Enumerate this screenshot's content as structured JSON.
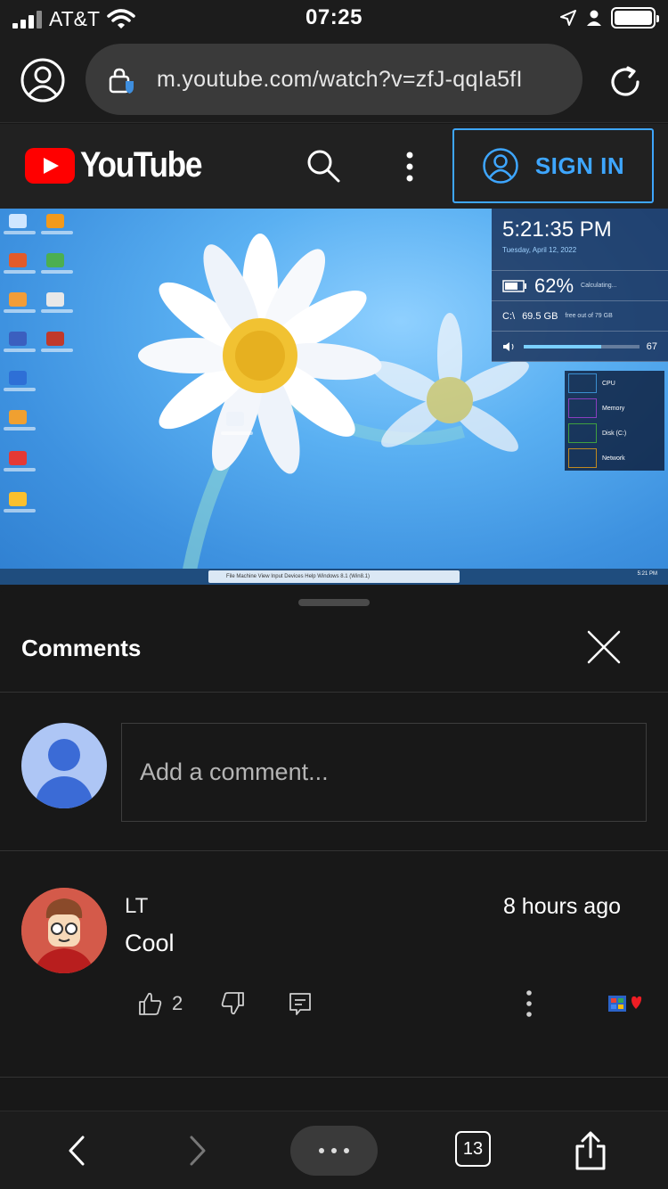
{
  "status_bar": {
    "carrier": "AT&T",
    "time": "07:25"
  },
  "browser": {
    "url": "m.youtube.com/watch?v=zfJ-qqIa5fI"
  },
  "youtube_header": {
    "logo_text": "YouTube",
    "sign_in_label": "SIGN IN",
    "accent_color": "#3ea6ff"
  },
  "video": {
    "gadget_time": "5:21:35 PM",
    "gadget_date": "Tuesday, April 12, 2022",
    "battery_percent": "62%",
    "battery_status": "Calculating...",
    "disk_label": "C:\\",
    "disk_free": "69.5 GB",
    "disk_note": "free out of 79 GB",
    "volume_value": "67",
    "volume_level": 0.67,
    "perf_items": [
      "CPU",
      "Memory",
      "Disk (C:)",
      "Network"
    ],
    "taskbar_title": "File  Machine  View  Input  Devices  Help   Windows 8.1 (Win8.1)",
    "taskbar_clock": "5:21 PM"
  },
  "comments_panel": {
    "title": "Comments",
    "input_placeholder": "Add a comment...",
    "comments": [
      {
        "author": "LT",
        "time": "8 hours ago",
        "text": "Cool",
        "likes": "2"
      }
    ]
  },
  "toolbar": {
    "tab_count": "13"
  },
  "icons": [
    "account-icon",
    "lock-icon",
    "reload-icon",
    "search-icon",
    "more-vert-icon",
    "user-circle-icon",
    "close-icon",
    "thumb-up-icon",
    "thumb-down-icon",
    "reply-icon",
    "back-icon",
    "forward-icon",
    "share-icon"
  ]
}
